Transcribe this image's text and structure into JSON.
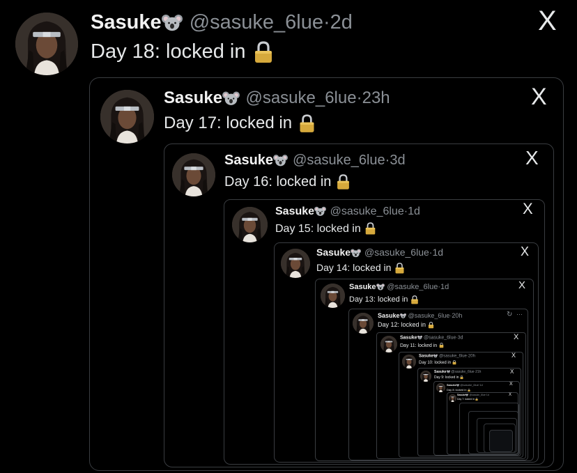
{
  "tweets": [
    {
      "name": "Sasuke",
      "handle": "@sasuke_6lue",
      "time": "2d",
      "text": "Day 18: locked in"
    },
    {
      "name": "Sasuke",
      "handle": "@sasuke_6lue",
      "time": "23h",
      "text": "Day 17: locked in"
    },
    {
      "name": "Sasuke",
      "handle": "@sasuke_6lue",
      "time": "3d",
      "text": "Day 16: locked in"
    },
    {
      "name": "Sasuke",
      "handle": "@sasuke_6lue",
      "time": "1d",
      "text": "Day 15: locked in"
    },
    {
      "name": "Sasuke",
      "handle": "@sasuke_6lue",
      "time": "1d",
      "text": "Day 14: locked in"
    },
    {
      "name": "Sasuke",
      "handle": "@sasuke_6lue",
      "time": "1d",
      "text": "Day 13: locked in"
    },
    {
      "name": "Sasuke",
      "handle": "@sasuke_6lue",
      "time": "20h",
      "text": "Day 12: locked in"
    },
    {
      "name": "Sasuke",
      "handle": "@sasuke_6lue",
      "time": "3d",
      "text": "Day 11: locked in"
    },
    {
      "name": "Sasuke",
      "handle": "@sasuke_6lue",
      "time": "20h",
      "text": "Day 10: locked in"
    },
    {
      "name": "Sasuke",
      "handle": "@sasuke_6lue",
      "time": "21h",
      "text": "Day 9: locked in"
    },
    {
      "name": "Sasuke",
      "handle": "@sasuke_6lue",
      "time": "1d",
      "text": "Day 8: locked in"
    },
    {
      "name": "Sasuke",
      "handle": "@sasuke_6lue",
      "time": "1d",
      "text": "Day 7: locked in"
    }
  ],
  "separator": "·",
  "x_logo": "X",
  "dots": "···",
  "icons": {
    "badge": "koala-emoji",
    "lock": "lock-emoji",
    "brand": "x-logo",
    "refresh": "refresh-icon"
  },
  "colors": {
    "background": "#000000",
    "text": "#e7e9ea",
    "muted": "#8b9096",
    "border": "#3a3d41",
    "lock_gold": "#d6a93c"
  }
}
